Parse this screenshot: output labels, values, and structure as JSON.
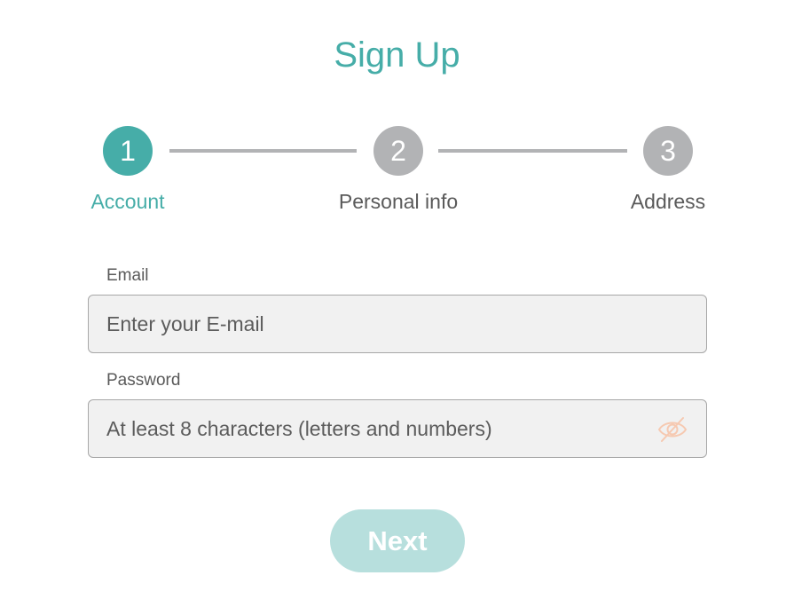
{
  "page": {
    "title": "Sign Up"
  },
  "stepper": {
    "steps": [
      {
        "number": "1",
        "label": "Account",
        "state": "active"
      },
      {
        "number": "2",
        "label": "Personal info",
        "state": "inactive"
      },
      {
        "number": "3",
        "label": "Address",
        "state": "inactive"
      }
    ]
  },
  "form": {
    "email": {
      "label": "Email",
      "value": "",
      "placeholder": "Enter your E-mail"
    },
    "password": {
      "label": "Password",
      "value": "",
      "placeholder": "At least 8 characters (letters and numbers)",
      "toggle_icon": "eye-off-icon"
    },
    "next_label": "Next"
  },
  "colors": {
    "accent": "#46ada8",
    "inactive": "#b2b3b5",
    "button_disabled_bg": "#b7dfdd",
    "eye_icon": "#f6c9b1"
  }
}
